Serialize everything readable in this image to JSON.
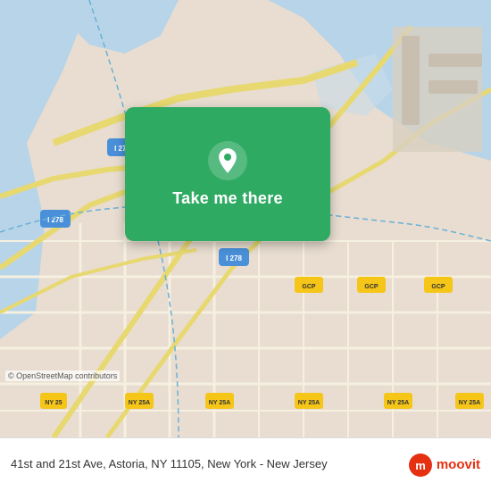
{
  "map": {
    "background_color": "#e8e0d8",
    "osm_credit": "© OpenStreetMap contributors"
  },
  "action_card": {
    "button_label": "Take me there",
    "pin_icon": "location-pin"
  },
  "bottom_bar": {
    "address": "41st and 21st Ave, Astoria, NY 11105, New York -\nNew Jersey",
    "logo_name": "moovit",
    "logo_tagline": "moovit"
  }
}
